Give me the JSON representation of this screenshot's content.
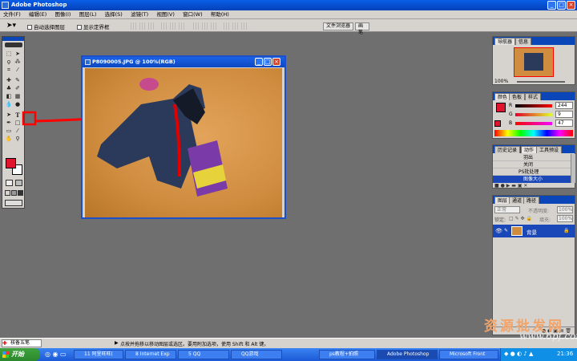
{
  "window": {
    "title": "Adobe Photoshop",
    "min": "_",
    "max": "□",
    "close": "×"
  },
  "menu": [
    "文件(F)",
    "编辑(E)",
    "图像(I)",
    "图层(L)",
    "选择(S)",
    "滤镜(T)",
    "视图(V)",
    "窗口(W)",
    "帮助(H)"
  ],
  "options": {
    "auto_select_label": "自动选择图层",
    "show_bounds_label": "显示定界框",
    "palette_tabs": [
      "文件浏览器",
      "画笔"
    ]
  },
  "document": {
    "title": "P8090005.JPG @ 100%(RGB)"
  },
  "navigator": {
    "tabs": [
      "导航器",
      "信息"
    ],
    "zoom": "100%"
  },
  "color": {
    "tabs": [
      "颜色",
      "色板",
      "样式"
    ],
    "channels": [
      {
        "label": "R",
        "value": "244",
        "color": "#ee2222"
      },
      {
        "label": "G",
        "value": "9",
        "color": "#22aa22"
      },
      {
        "label": "B",
        "value": "47",
        "color": "#2244ee"
      }
    ],
    "foreground": "#e0142c",
    "background": "#ffffff"
  },
  "history": {
    "tabs": [
      "历史记录",
      "动作",
      "工具预设"
    ],
    "items": [
      "羽出",
      "关闭",
      "PS批处理",
      "图像大小"
    ]
  },
  "layers": {
    "tabs": [
      "图层",
      "通道",
      "路径"
    ],
    "blend_mode": "正常",
    "opacity_label": "不透明度:",
    "opacity_value": "100%",
    "lock_label": "锁定:",
    "fill_label": "填充:",
    "fill_value": "100%",
    "layer_name": "背景"
  },
  "status": {
    "zoom_field": "核备五笔",
    "message": "点按并拖移以移动图层或选区。要用附加选项，使用 Shift 和 Alt 键。"
  },
  "taskbar": {
    "start": "开始",
    "tasks": [
      "11 阿里旺旺(",
      "8 Internet Exp",
      "5 QQ",
      "QQ游戏",
      "ps教程+拍照",
      "Adobe Photoshop",
      "Microsoft Front"
    ],
    "clock": "21:36"
  },
  "watermark": {
    "line1": "资源批发网",
    "line2": "www.6pf.com"
  }
}
